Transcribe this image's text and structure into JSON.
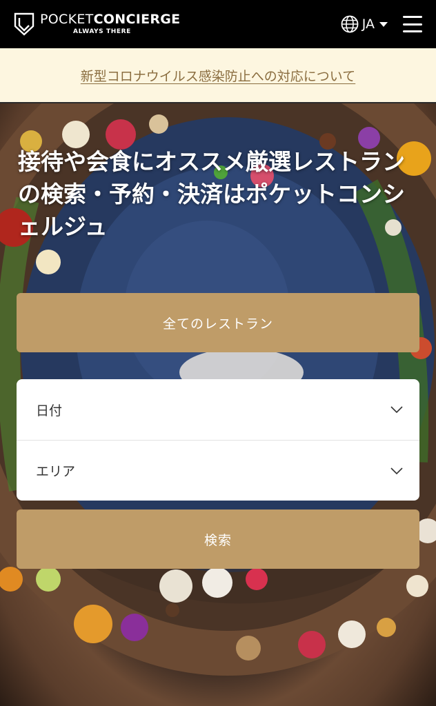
{
  "header": {
    "logo_light": "POCKET",
    "logo_bold": "CONCIERGE",
    "logo_sub": "ALWAYS THERE",
    "language": "JA",
    "icons": [
      "shield-logo-icon",
      "globe-icon",
      "caret-down-icon",
      "hamburger-menu-icon"
    ]
  },
  "notice": {
    "link_text": "新型コロナウイルス感染防止への対応について"
  },
  "hero": {
    "headline": "接待や会食にオススメ厳選レストランの検索・予約・決済はポケットコンシェルジュ",
    "all_restaurants_button": "全てのレストラン",
    "filters": {
      "date_label": "日付",
      "area_label": "エリア"
    },
    "search_button": "検索"
  },
  "colors": {
    "header_bg": "#000000",
    "notice_bg": "#fdf6e0",
    "notice_link": "#8a6d3f",
    "accent_gold": "#bf9c68",
    "filter_bg": "#ffffff"
  }
}
